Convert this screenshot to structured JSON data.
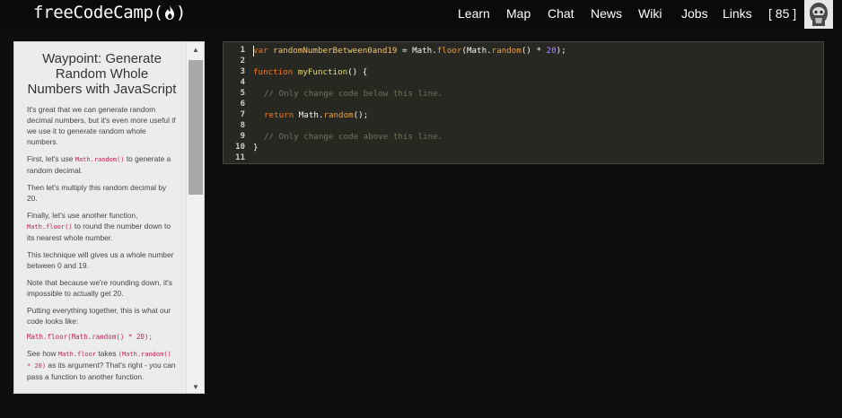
{
  "navbar": {
    "logo_text": "freeCodeCamp",
    "links": [
      "Learn",
      "Map",
      "Chat",
      "News",
      "Wiki",
      "Jobs",
      "Links"
    ],
    "points": "[ 85 ]"
  },
  "panel": {
    "title": "Waypoint: Generate Random Whole Numbers with JavaScript",
    "p1": "It's great that we can generate random decimal numbers, but it's even more useful if we use it to generate random whole numbers.",
    "p2_before": "First, let's use ",
    "p2_code": "Math.random()",
    "p2_after": " to generate a random decimal.",
    "p3": "Then let's multiply this random decimal by 20.",
    "p4_before": "Finally, let's use another function, ",
    "p4_code": "Math.floor()",
    "p4_after": " to round the number down to its nearest whole number.",
    "p5": "This technique will gives us a whole number between 0 and 19.",
    "p6": "Note that because we're rounding down, it's impossible to actually get 20.",
    "p7": "Putting everything together, this is what our code looks like:",
    "code_example": "Math.floor(Math.random() * 20);",
    "p8_before": "See how ",
    "p8_code1": "Math.floor",
    "p8_mid": " takes ",
    "p8_code2": "(Math.random() * 20)",
    "p8_after": " as its argument? That's right - you can pass a function to another function."
  },
  "editor": {
    "line_numbers": [
      "1",
      "2",
      "3",
      "4",
      "5",
      "6",
      "7",
      "8",
      "9",
      "10",
      "11"
    ],
    "line1": {
      "kw": "var",
      "name": "randomNumberBetween0and19",
      "eq": " = ",
      "obj1": "Math",
      "dot1": ".",
      "m1": "floor",
      "p1": "(",
      "obj2": "Math",
      "dot2": ".",
      "m2": "random",
      "rest": "() * ",
      "num": "20",
      "end": ");"
    },
    "line3": {
      "kw": "function",
      "name": "myFunction",
      "rest": "() {"
    },
    "line5": "// Only change code below this line.",
    "line7": {
      "kw": "return",
      "obj": "Math",
      "dot": ".",
      "m": "random",
      "rest": "();"
    },
    "line9": "// Only change code above this line.",
    "line10": "}"
  }
}
